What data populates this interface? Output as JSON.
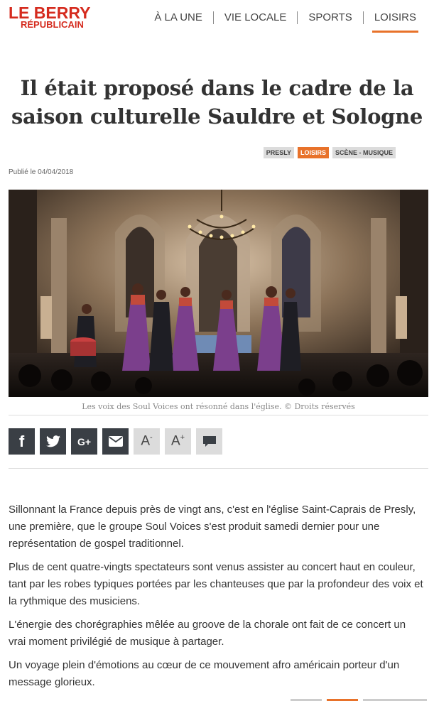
{
  "brand": {
    "line1": "LE BERRY",
    "line2": "RÉPUBLICAIN",
    "color": "#d52b1e"
  },
  "nav": {
    "items": [
      {
        "label": "À LA UNE"
      },
      {
        "label": "VIE LOCALE"
      },
      {
        "label": "SPORTS"
      },
      {
        "label": "LOISIRS",
        "active": true
      }
    ],
    "accent": "#e8722a"
  },
  "article": {
    "title": "Il était proposé dans le cadre de la saison culturelle Sauldre et Sologne",
    "tags": [
      "PRESLY",
      "LOISIRS",
      "SCÈNE - MUSIQUE"
    ],
    "published": "Publié le 04/04/2018",
    "caption": "Les voix des Soul Voices ont résonné dans l'église. © Droits réservés",
    "paragraphs": [
      "Sillonnant la France depuis près de vingt ans, c'est en l'église Saint-Caprais de Presly, une première, que le groupe Soul Voices s'est produit samedi dernier pour une représentation de gospel traditionnel.",
      "Plus de cent quatre-vingts spectateurs sont venus assister au concert haut en couleur, tant par les robes typiques portées par les chanteuses que par la profondeur des voix et la rythmique des musiciens.",
      "L'énergie des chorégraphies mêlée au groove de la chorale ont fait de ce concert un vrai moment privilégié de musique à partager.",
      "Un voyage plein d'émotions au cœur de ce mouvement afro américain porteur d'un message glorieux."
    ]
  },
  "share": {
    "buttons": [
      {
        "icon": "facebook-icon",
        "glyph": "f"
      },
      {
        "icon": "twitter-icon"
      },
      {
        "icon": "google-plus-icon",
        "glyph": "G+"
      },
      {
        "icon": "email-icon"
      },
      {
        "icon": "font-decrease-icon",
        "glyph": "A",
        "sup": "-"
      },
      {
        "icon": "font-increase-icon",
        "glyph": "A",
        "sup": "+"
      },
      {
        "icon": "comment-icon"
      }
    ]
  }
}
